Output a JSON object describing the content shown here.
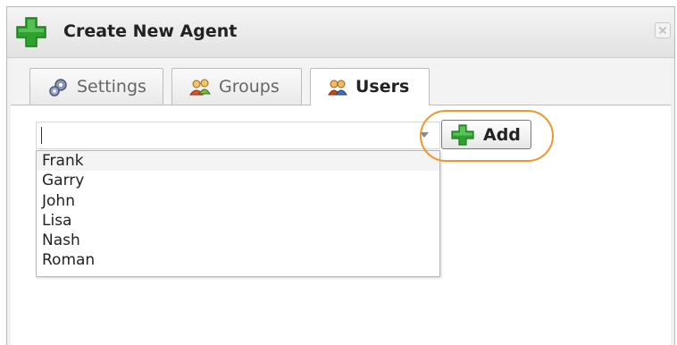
{
  "dialog": {
    "title": "Create New Agent",
    "title_icon": "green-plus-icon",
    "close_icon": "close-icon"
  },
  "tabs": [
    {
      "label": "Settings",
      "icon": "gears-icon",
      "active": false
    },
    {
      "label": "Groups",
      "icon": "groups-icon",
      "active": false
    },
    {
      "label": "Users",
      "icon": "users-icon",
      "active": true
    }
  ],
  "users_tab": {
    "combo_value": "",
    "add_button_label": "Add",
    "add_button_icon": "green-plus-icon",
    "highlight_color": "#f0962a",
    "options": [
      "Frank",
      "Garry",
      "John",
      "Lisa",
      "Nash",
      "Roman"
    ],
    "highlighted_option": "Frank"
  },
  "colors": {
    "plus_green": "#2ea12e",
    "highlight_orange": "#f0962a"
  }
}
